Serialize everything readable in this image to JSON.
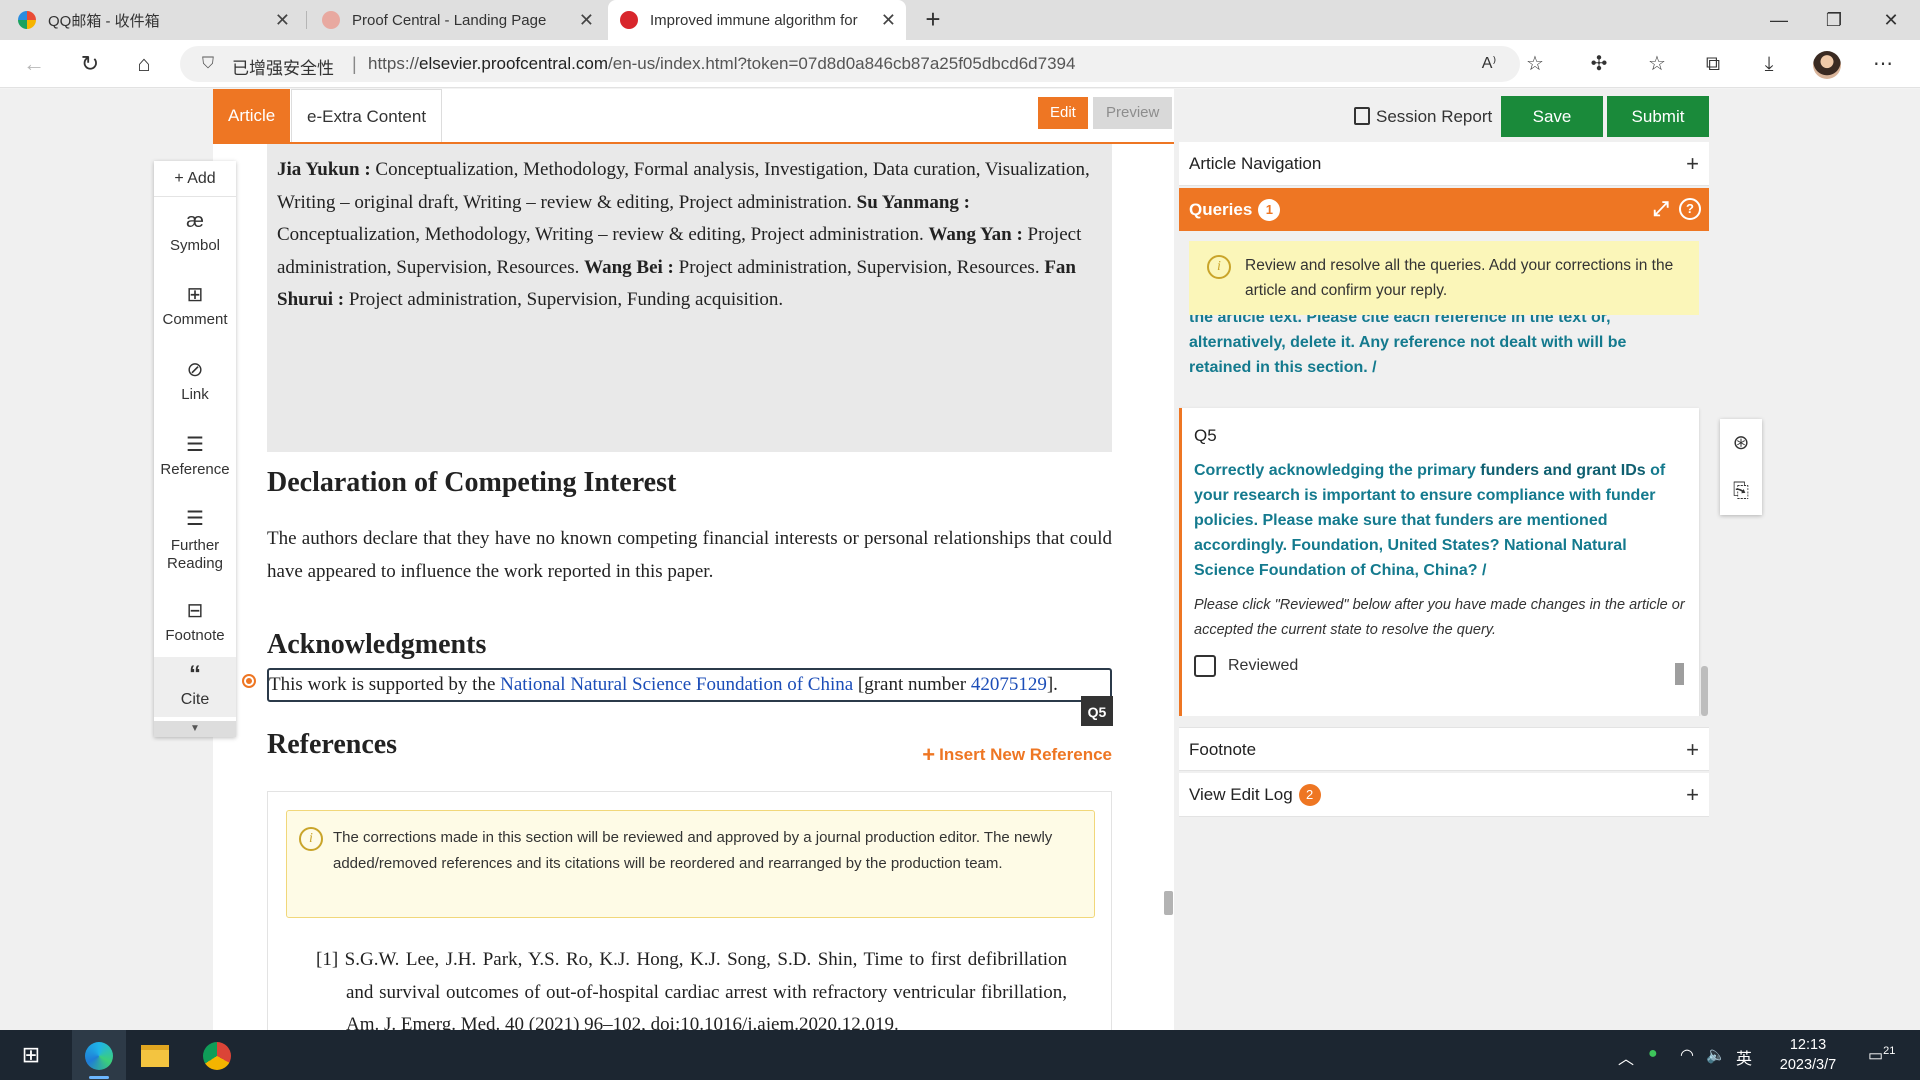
{
  "browser": {
    "tabs": [
      {
        "title": "QQ邮箱 - 收件箱",
        "favicon_color": "#2a8de0"
      },
      {
        "title": "Proof Central - Landing Page",
        "favicon_color": "#e8a9a0"
      },
      {
        "title": "Improved immune algorithm for",
        "favicon_color": "#d8262c"
      }
    ],
    "active_tab": 2,
    "security_label": "已增强安全性",
    "url_prefix": "https://",
    "url_host": "elsevier.proofcentral.com",
    "url_path": "/en-us/index.html?token=07d8d0a846cb87a25f05dbcd6d7394"
  },
  "app": {
    "tabs": {
      "article": "Article",
      "extra": "e-Extra Content"
    },
    "mode": {
      "edit": "Edit",
      "preview": "Preview"
    },
    "session_report": "Session Report",
    "save": "Save",
    "submit": "Submit",
    "tools": {
      "add": "+ Add",
      "symbol": "Symbol",
      "comment": "Comment",
      "link": "Link",
      "reference": "Reference",
      "further_reading_1": "Further",
      "further_reading_2": "Reading",
      "footnote": "Footnote",
      "cite": "Cite"
    }
  },
  "document": {
    "credits": {
      "n1": "Jia Yukun :",
      "t1": " Conceptualization, Methodology, Formal analysis, Investigation, Data curation, Visualization, Writing – original draft, Writing – review & editing, Project administration.",
      "n2": "Su Yanmang :",
      "t2": " Conceptualization, Methodology, Writing – review & editing, Project administration.",
      "n3": "Wang Yan :",
      "t3": " Project administration, Supervision, Resources.",
      "n4": "Wang Bei :",
      "t4": " Project administration, Supervision, Resources.",
      "n5": "Fan Shurui :",
      "t5": " Project administration, Supervision, Funding acquisition."
    },
    "competing_heading": "Declaration of Competing Interest",
    "competing_text": "The authors declare that they have no known competing financial interests or personal relationships that could have appeared to influence the work reported in this paper.",
    "ack_heading": "Acknowledgments",
    "ack": {
      "pre": "This work is supported by the ",
      "funder": "National Natural Science Foundation of China",
      "mid": " [grant number ",
      "grant": "42075129",
      "post": "]."
    },
    "q5_tag": "Q5",
    "refs_heading": "References",
    "insert_ref": "Insert New Reference",
    "refs_notice": "The corrections made in this section will be reviewed and approved by a journal production editor. The newly added/removed references and its citations will be reordered and rearranged by the production team.",
    "ref1": "[1] S.G.W. Lee, J.H. Park, Y.S. Ro, K.J. Hong, K.J. Song, S.D. Shin, Time to first defibrillation and survival outcomes of out-of-hospital cardiac arrest with refractory ventricular fibrillation, Am. J. Emerg. Med. 40 (2021) 96–102, doi:10.1016/j.ajem.2020.12.019."
  },
  "right_panel": {
    "article_nav": "Article Navigation",
    "queries": "Queries",
    "queries_count": "1",
    "queries_info": "Review and resolve all the queries. Add your corrections in the article and confirm your reply.",
    "prev_query_tail": "the article text. Please cite each reference in the text or, alternatively, delete it. Any reference not dealt with will be retained in this section. /",
    "q5": {
      "id": "Q5",
      "text_a": "Correctly acknowledging the primary ",
      "text_b": "funders and grant IDs",
      "text_c": " of your research is important to ensure compliance with funder policies. Please make sure that funders are mentioned accordingly. Foundation, United States? National Natural Science Foundation of China, China? /",
      "hint": "Please click \"Reviewed\" below after you have made changes in the article or accepted the current state to resolve the query.",
      "reviewed": "Reviewed"
    },
    "footnote": "Footnote",
    "edit_log": "View Edit Log",
    "edit_log_count": "2"
  },
  "taskbar": {
    "ime": "英",
    "time": "12:13",
    "date": "2023/3/7",
    "notif": "21"
  }
}
